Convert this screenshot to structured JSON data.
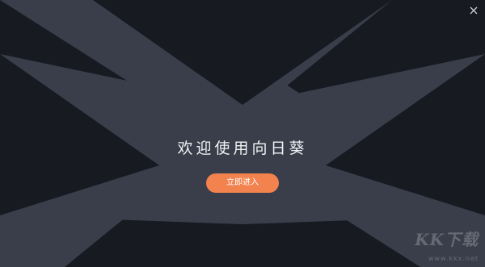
{
  "window": {
    "title": "欢迎使用向日葵",
    "close_icon": "close-icon"
  },
  "main": {
    "welcome_title": "欢迎使用向日葵",
    "enter_button_label": "立即进入"
  },
  "watermark": {
    "main": "KK下载",
    "sub": "www.kkx.net"
  },
  "colors": {
    "background": "#181a22",
    "x_shape": "#393e4a",
    "accent": "#f2834f",
    "title_text": "#f1f2f5"
  }
}
